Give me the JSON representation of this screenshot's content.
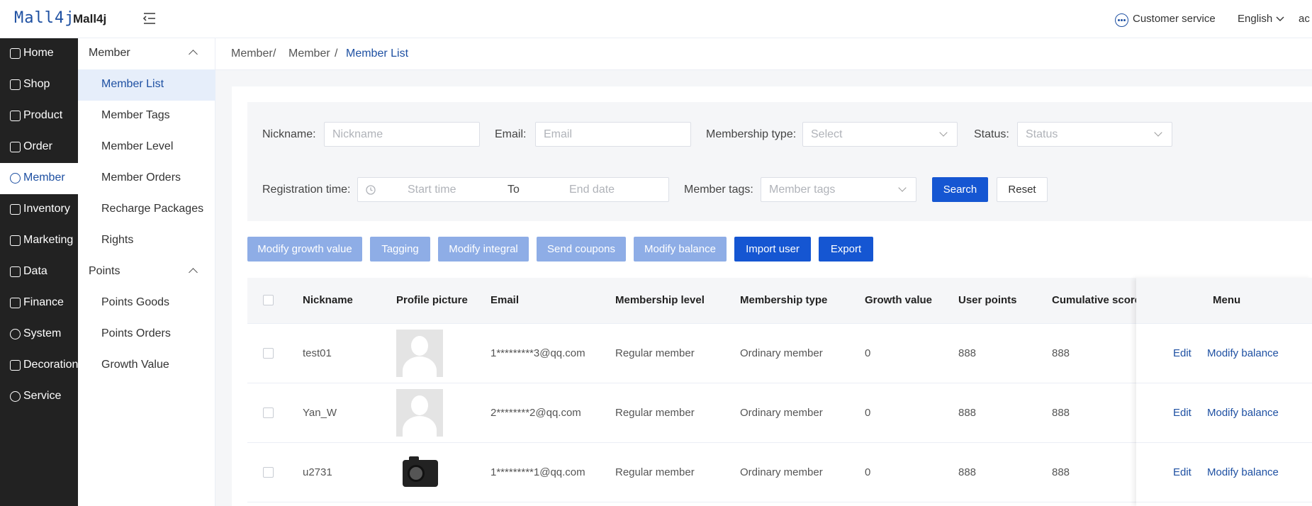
{
  "header": {
    "logo_text": "Mall4j",
    "brand": "Mall4j",
    "customer_service": "Customer service",
    "language": "English",
    "user": "ac"
  },
  "sidebar": {
    "items": [
      {
        "label": "Home",
        "icon": "home-icon"
      },
      {
        "label": "Shop",
        "icon": "shop-icon"
      },
      {
        "label": "Product",
        "icon": "product-icon"
      },
      {
        "label": "Order",
        "icon": "order-icon"
      },
      {
        "label": "Member",
        "icon": "member-icon"
      },
      {
        "label": "Inventory",
        "icon": "inventory-icon"
      },
      {
        "label": "Marketing",
        "icon": "gift-icon"
      },
      {
        "label": "Data",
        "icon": "chart-icon"
      },
      {
        "label": "Finance",
        "icon": "finance-icon"
      },
      {
        "label": "System",
        "icon": "gear-icon"
      },
      {
        "label": "Decoration",
        "icon": "decoration-icon"
      },
      {
        "label": "Service",
        "icon": "chat-icon"
      }
    ],
    "active": "Member"
  },
  "submenu": {
    "groups": [
      {
        "label": "Member",
        "items": [
          "Member List",
          "Member Tags",
          "Member Level",
          "Member Orders",
          "Recharge Packages",
          "Rights"
        ]
      },
      {
        "label": "Points",
        "items": [
          "Points Goods",
          "Points Orders",
          "Growth Value"
        ]
      }
    ],
    "active": "Member List"
  },
  "breadcrumb": {
    "items": [
      "Member",
      "Member",
      "Member List"
    ],
    "separator": "/"
  },
  "filters": {
    "nickname_label": "Nickname:",
    "nickname_placeholder": "Nickname",
    "email_label": "Email:",
    "email_placeholder": "Email",
    "membership_type_label": "Membership type:",
    "membership_type_placeholder": "Select",
    "status_label": "Status:",
    "status_placeholder": "Status",
    "registration_label": "Registration time:",
    "start_placeholder": "Start time",
    "range_separator": "To",
    "end_placeholder": "End date",
    "tags_label": "Member tags:",
    "tags_placeholder": "Member tags",
    "search": "Search",
    "reset": "Reset"
  },
  "actions": {
    "modify_growth": "Modify growth value",
    "tagging": "Tagging",
    "modify_integral": "Modify integral",
    "send_coupons": "Send coupons",
    "modify_balance": "Modify balance",
    "import_user": "Import user",
    "export": "Export"
  },
  "table": {
    "columns": [
      "Nickname",
      "Profile picture",
      "Email",
      "Membership level",
      "Membership type",
      "Growth value",
      "User points",
      "Cumulative score",
      "Menu"
    ],
    "rows": [
      {
        "nickname": "test01",
        "picture": "default-avatar",
        "email": "1*********3@qq.com",
        "level": "Regular member",
        "type": "Ordinary member",
        "growth": "0",
        "points": "888",
        "cumulative": "888"
      },
      {
        "nickname": "Yan_W",
        "picture": "default-avatar",
        "email": "2********2@qq.com",
        "level": "Regular member",
        "type": "Ordinary member",
        "growth": "0",
        "points": "888",
        "cumulative": "888"
      },
      {
        "nickname": "u2731",
        "picture": "camera-photo",
        "email": "1*********1@qq.com",
        "level": "Regular member",
        "type": "Ordinary member",
        "growth": "0",
        "points": "888",
        "cumulative": "888"
      }
    ],
    "row_actions": {
      "edit": "Edit",
      "modify_balance": "Modify balance"
    }
  },
  "colors": {
    "primary": "#1556d2",
    "primary_light": "#8eade6",
    "sidebar_bg": "#222222",
    "active_text": "#1e50a2"
  }
}
